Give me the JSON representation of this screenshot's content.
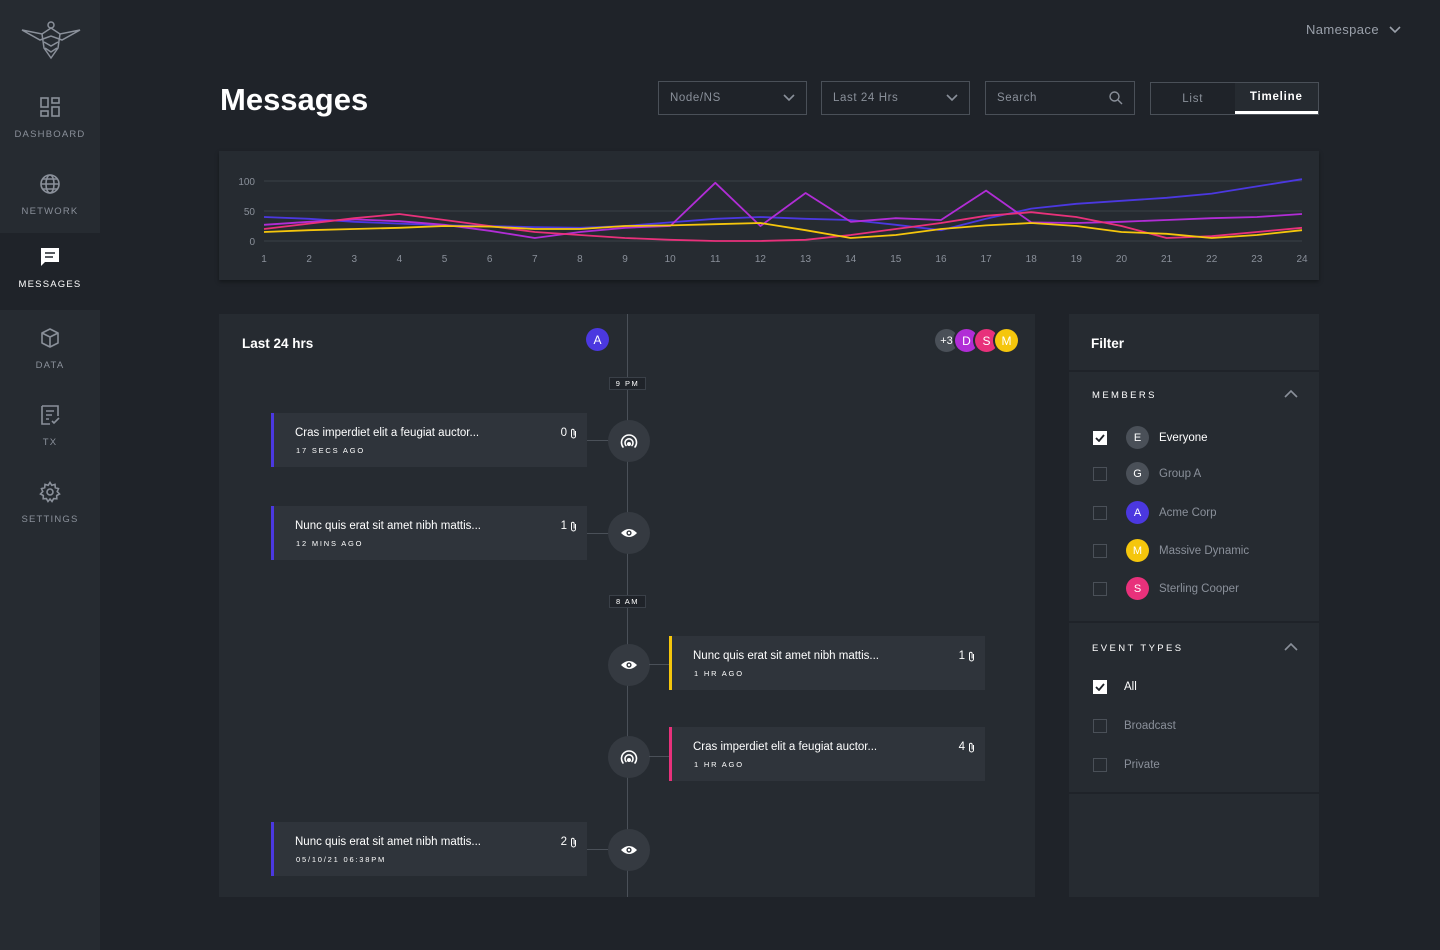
{
  "sidebar": {
    "items": [
      {
        "label": "DASHBOARD",
        "icon": "dashboard-icon",
        "active": false
      },
      {
        "label": "NETWORK",
        "icon": "globe-icon",
        "active": false
      },
      {
        "label": "MESSAGES",
        "icon": "message-icon",
        "active": true
      },
      {
        "label": "DATA",
        "icon": "cube-icon",
        "active": false
      },
      {
        "label": "TX",
        "icon": "document-check-icon",
        "active": false
      },
      {
        "label": "SETTINGS",
        "icon": "gear-icon",
        "active": false
      }
    ]
  },
  "header": {
    "namespace_label": "Namespace",
    "title": "Messages",
    "node_select": "Node/NS",
    "time_select": "Last 24 Hrs",
    "search_placeholder": "Search",
    "view_list": "List",
    "view_timeline": "Timeline",
    "active_view": "Timeline"
  },
  "colors": {
    "purple": "#4b38e0",
    "violet": "#b12dd6",
    "pink": "#e8317b",
    "yellow": "#f5c60c",
    "background": "#1f2329",
    "card": "#262b31"
  },
  "chart_data": {
    "type": "line",
    "x": [
      1,
      2,
      3,
      4,
      5,
      6,
      7,
      8,
      9,
      10,
      11,
      12,
      13,
      14,
      15,
      16,
      17,
      18,
      19,
      20,
      21,
      22,
      23,
      24
    ],
    "ylim": [
      0,
      100
    ],
    "y_ticks": [
      "100",
      "50",
      "0"
    ],
    "grid": true,
    "series": [
      {
        "color": "#4b38e0",
        "values": [
          40,
          37,
          32,
          29,
          26,
          25,
          23,
          22,
          25,
          31,
          37,
          40,
          37,
          35,
          27,
          18,
          37,
          54,
          62,
          67,
          72,
          79,
          91,
          103
        ]
      },
      {
        "color": "#b12dd6",
        "values": [
          27,
          32,
          36,
          33,
          27,
          17,
          5,
          15,
          22,
          25,
          97,
          25,
          80,
          32,
          38,
          35,
          84,
          31,
          30,
          32,
          35,
          38,
          40,
          45
        ]
      },
      {
        "color": "#e8317b",
        "values": [
          20,
          29,
          38,
          45,
          35,
          25,
          15,
          10,
          5,
          2,
          0,
          0,
          2,
          10,
          20,
          30,
          42,
          48,
          40,
          25,
          5,
          8,
          15,
          22
        ]
      },
      {
        "color": "#f5c60c",
        "values": [
          15,
          18,
          20,
          22,
          25,
          24,
          20,
          20,
          25,
          26,
          28,
          30,
          18,
          5,
          10,
          20,
          26,
          30,
          25,
          15,
          12,
          5,
          10,
          18
        ]
      }
    ]
  },
  "timeline": {
    "title": "Last 24 hrs",
    "left_avatar": "A",
    "right_avatars": [
      "+3",
      "D",
      "S",
      "M"
    ],
    "time_labels": [
      "9 PM",
      "8 AM"
    ],
    "messages": [
      {
        "text": "Cras imperdiet elit a feugiat auctor...",
        "time": "17 SECS AGO",
        "count": "0",
        "node_icon": "broadcast-icon"
      },
      {
        "text": "Nunc quis erat sit amet nibh mattis...",
        "time": "12 MINS AGO",
        "count": "1",
        "node_icon": "eye-icon"
      },
      {
        "text": "Nunc quis erat sit amet nibh mattis...",
        "time": "1 HR AGO",
        "count": "1",
        "node_icon": "eye-icon"
      },
      {
        "text": "Cras imperdiet elit a feugiat auctor...",
        "time": "1 HR AGO",
        "count": "4",
        "node_icon": "broadcast-icon"
      },
      {
        "text": "Nunc quis erat sit amet nibh mattis...",
        "time": "05/10/21 06:38PM",
        "count": "2",
        "node_icon": "eye-icon"
      }
    ]
  },
  "filter": {
    "title": "Filter",
    "members_heading": "MEMBERS",
    "members": [
      {
        "initial": "E",
        "name": "Everyone",
        "checked": true
      },
      {
        "initial": "G",
        "name": "Group A",
        "checked": false
      },
      {
        "initial": "A",
        "name": "Acme Corp",
        "checked": false
      },
      {
        "initial": "M",
        "name": "Massive Dynamic",
        "checked": false
      },
      {
        "initial": "S",
        "name": "Sterling Cooper",
        "checked": false
      }
    ],
    "event_types_heading": "EVENT TYPES",
    "event_types": [
      {
        "name": "All",
        "checked": true
      },
      {
        "name": "Broadcast",
        "checked": false
      },
      {
        "name": "Private",
        "checked": false
      }
    ]
  }
}
